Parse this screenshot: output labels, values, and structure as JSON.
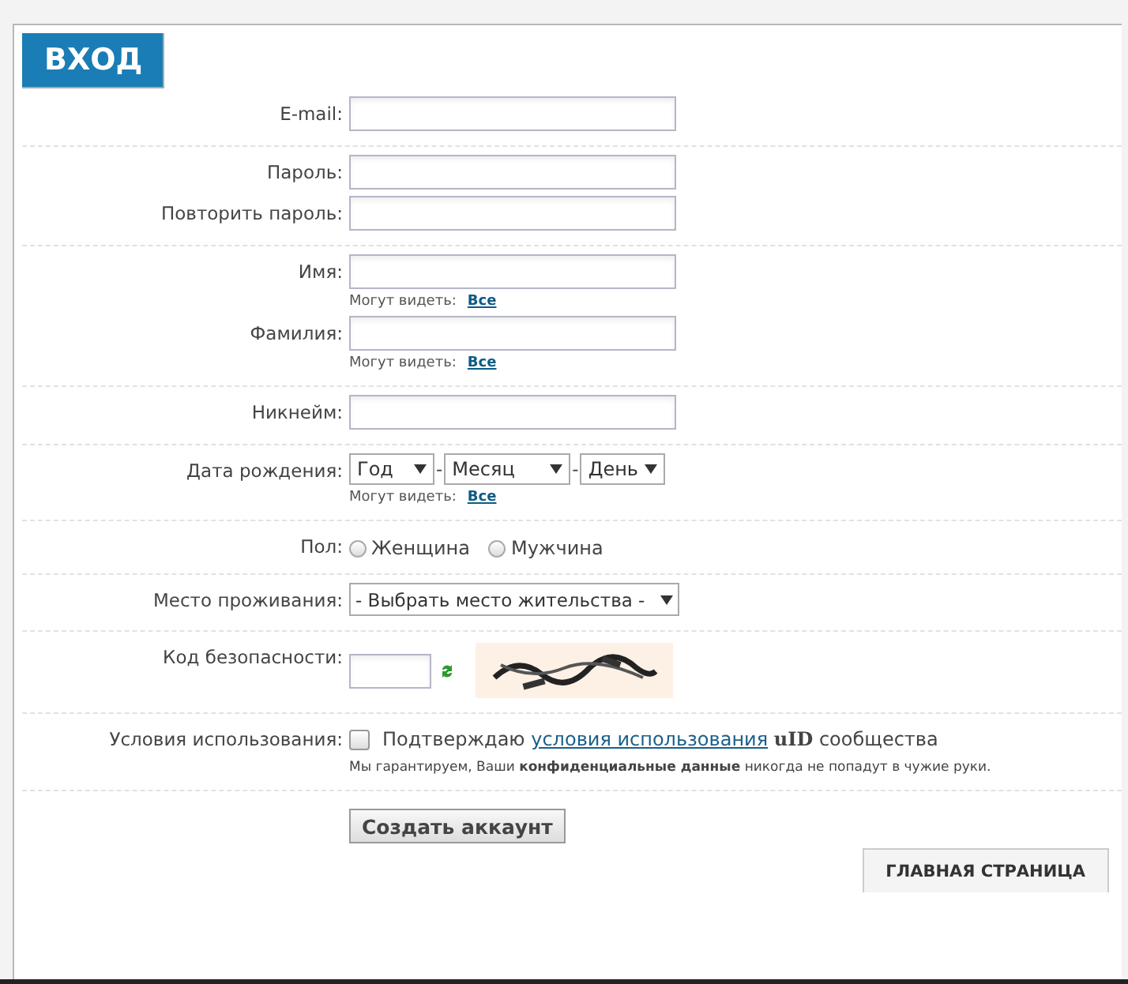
{
  "header": {
    "title": "ВХОД"
  },
  "sections": [
    {
      "rows": [
        {
          "kind": "text",
          "label": "E-mail:",
          "value": ""
        }
      ]
    },
    {
      "rows": [
        {
          "kind": "text",
          "label": "Пароль:"
        },
        {
          "kind": "text",
          "label": "Повторить пароль:"
        }
      ]
    },
    {
      "rows": [
        {
          "kind": "text",
          "label": "Имя:",
          "visibility": {
            "label": "Могут видеть:",
            "link": "Все"
          }
        },
        {
          "kind": "text",
          "label": "Фамилия:",
          "visibility": {
            "label": "Могут видеть:",
            "link": "Все"
          }
        }
      ]
    },
    {
      "rows": [
        {
          "kind": "text",
          "label": "Никнейм:"
        }
      ]
    },
    {
      "rows": [
        {
          "kind": "date",
          "label": "Дата рождения:",
          "selects": [
            "Год",
            "Месяц",
            "День"
          ],
          "separator": "-",
          "visibility": {
            "label": "Могут видеть:",
            "link": "Все"
          }
        }
      ]
    },
    {
      "rows": [
        {
          "kind": "radio",
          "label": "Пол:",
          "options": [
            {
              "label": "Женщина",
              "selected": false
            },
            {
              "label": "Мужчина",
              "selected": false
            }
          ]
        }
      ]
    },
    {
      "rows": [
        {
          "kind": "select",
          "label": "Место проживания:",
          "value": "- Выбрать место жительства -"
        }
      ]
    },
    {
      "rows": [
        {
          "kind": "captcha",
          "label": "Код безопасности:"
        }
      ]
    },
    {
      "rows": [
        {
          "kind": "terms",
          "label": "Условия использования:",
          "checked": false,
          "before": "Подтверждаю",
          "link": "условия использования",
          "brand": "uID",
          "after": "сообщества",
          "note": "Мы гарантируем, Ваши **конфиденциальные данные** никогда не попадут в чужие руки."
        }
      ]
    }
  ],
  "submit": "Создать аккаунт",
  "home_button": "ГЛАВНАЯ СТРАНИЦА"
}
